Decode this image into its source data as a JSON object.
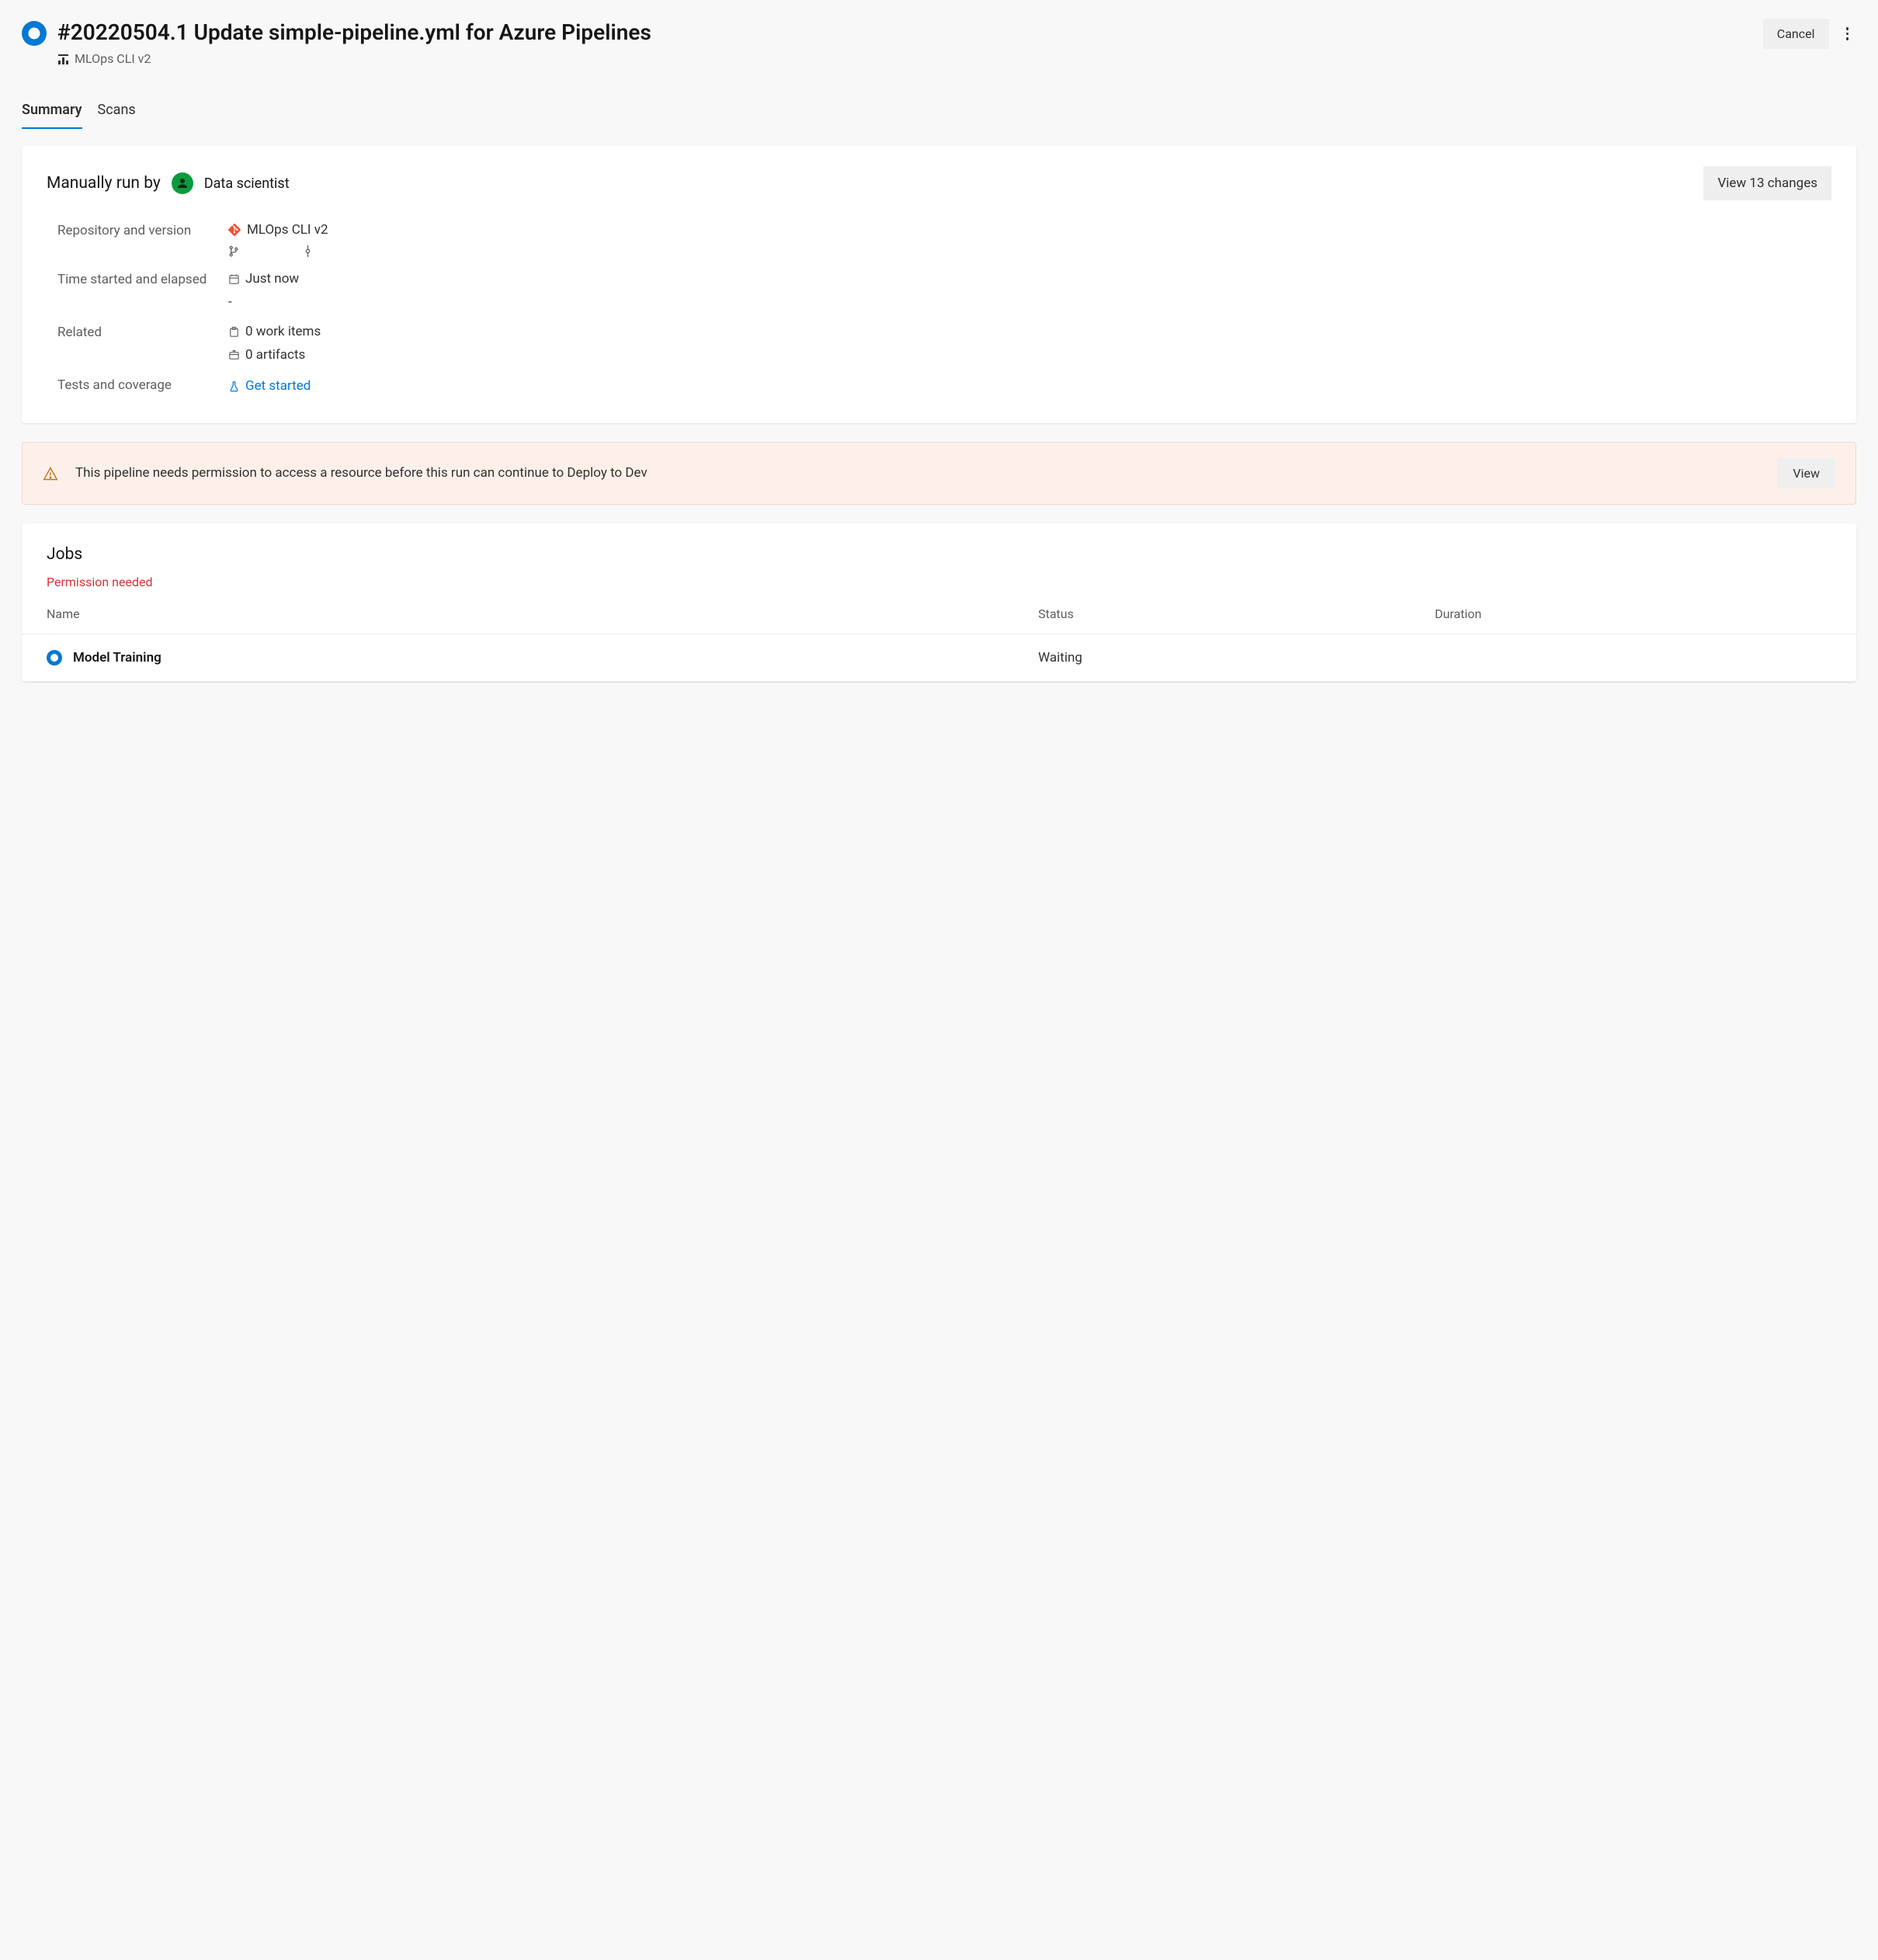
{
  "header": {
    "title": "#20220504.1 Update simple-pipeline.yml for Azure Pipelines",
    "pipeline_name": "MLOps CLI v2",
    "cancel_label": "Cancel"
  },
  "tabs": [
    {
      "label": "Summary",
      "active": true
    },
    {
      "label": "Scans",
      "active": false
    }
  ],
  "summary": {
    "run_by_label": "Manually run by",
    "user_name": "Data scientist",
    "view_changes_label": "View 13 changes",
    "rows": {
      "repo": {
        "label": "Repository and version",
        "repo_name": "MLOps CLI v2"
      },
      "time": {
        "label": "Time started and elapsed",
        "value": "Just now",
        "elapsed": "-"
      },
      "related": {
        "label": "Related",
        "work_items": "0 work items",
        "artifacts": "0 artifacts"
      },
      "tests": {
        "label": "Tests and coverage",
        "link": "Get started"
      }
    }
  },
  "warning": {
    "text": "This pipeline needs permission to access a resource before this run can continue to Deploy to Dev",
    "button": "View"
  },
  "jobs": {
    "title": "Jobs",
    "permission_text": "Permission needed",
    "columns": {
      "name": "Name",
      "status": "Status",
      "duration": "Duration"
    },
    "rows": [
      {
        "name": "Model Training",
        "status": "Waiting",
        "duration": ""
      }
    ]
  }
}
